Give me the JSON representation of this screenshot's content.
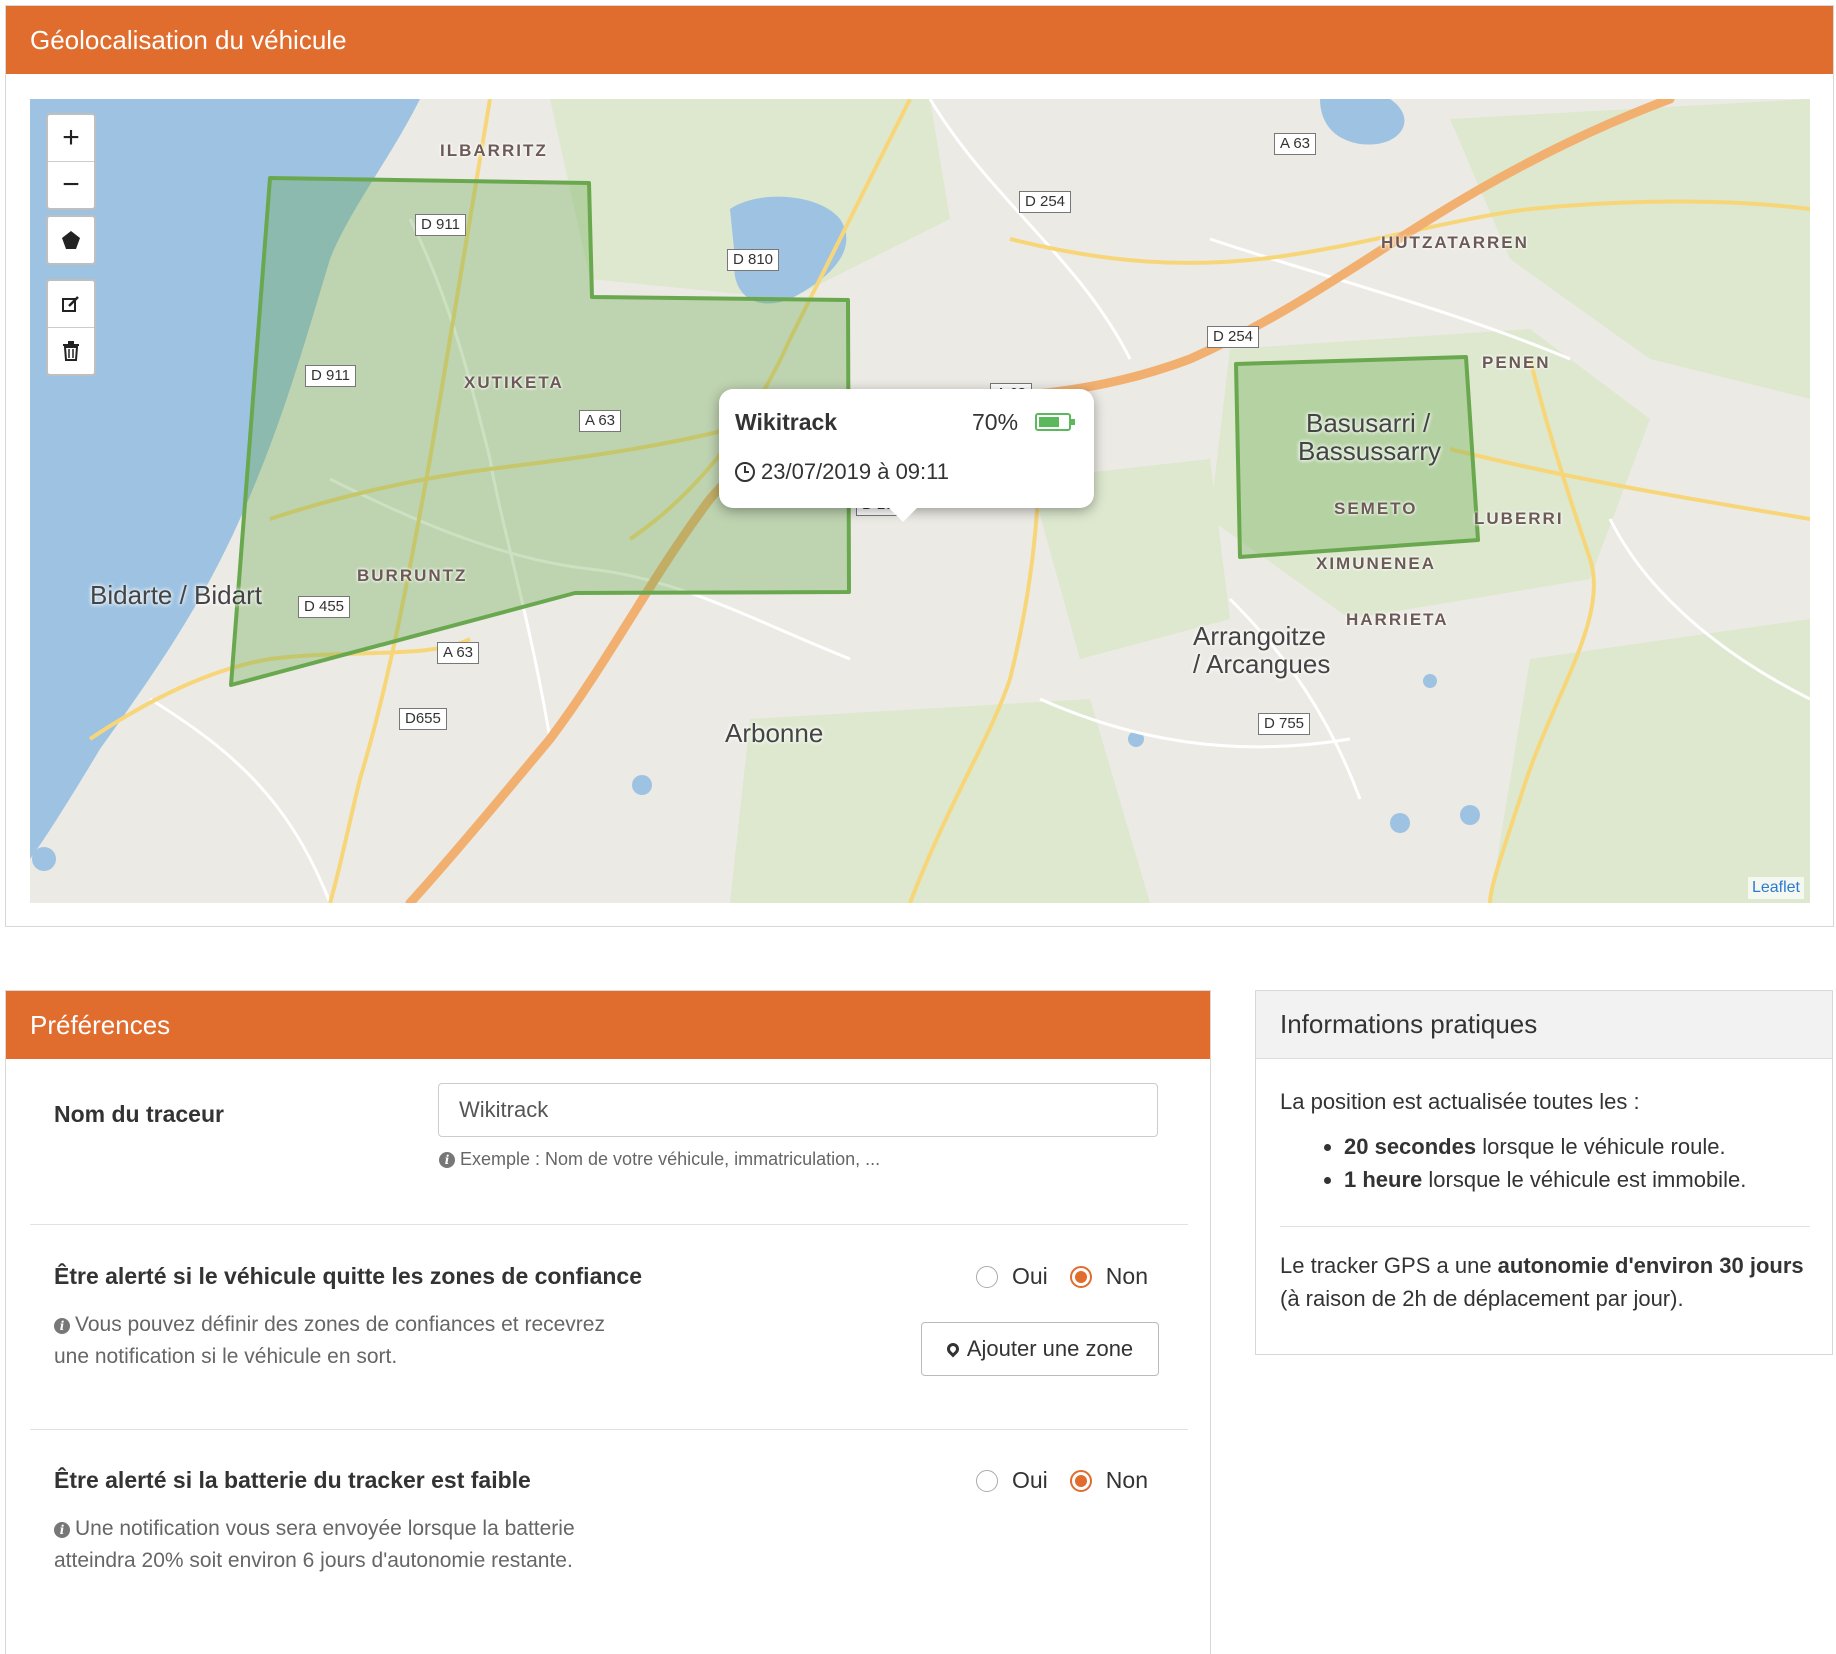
{
  "map_panel": {
    "title": "Géolocalisation du véhicule"
  },
  "map": {
    "controls": {
      "zoom_in": "+",
      "zoom_out": "−",
      "draw_polygon_icon": "polygon-icon",
      "edit_icon": "edit-icon",
      "delete_icon": "trash-icon"
    },
    "road_labels": [
      "D 911",
      "D 911",
      "D 810",
      "D 254",
      "A 63",
      "D 254",
      "A 63",
      "A 63",
      "D 255",
      "D 455",
      "A 63",
      "D655",
      "D 755"
    ],
    "place_labels": [
      "ILBARRITZ",
      "XUTIKETA",
      "BURRUNTZ",
      "HUTZATARREN",
      "PENEN",
      "SEMETO",
      "LUBERRI",
      "XIMUNENEA",
      "HARRIETA"
    ],
    "town_labels": [
      "Bidarte / Bidart",
      "Basusarri /",
      "Bassussarry",
      "Arrangoitze",
      "/ Arcangues",
      "Arbonne"
    ],
    "attribution": "Leaflet",
    "zone_color": "#6aa84f",
    "vehicle_icon": "truck-icon",
    "popup": {
      "tracker_name": "Wikitrack",
      "battery_percent": "70%",
      "battery_level": 0.7,
      "datetime": "23/07/2019 à 09:11"
    }
  },
  "preferences": {
    "title": "Préférences",
    "tracker_name_label": "Nom du traceur",
    "tracker_name_value": "Wikitrack",
    "tracker_name_hint": "Exemple : Nom de votre véhicule, immatriculation, ...",
    "zone_alert": {
      "label": "Être alerté si le véhicule quitte les zones de confiance",
      "hint_line1": "Vous pouvez définir des zones de confiances et recevrez",
      "hint_line2": "une notification si le véhicule en sort.",
      "yes": "Oui",
      "no": "Non",
      "selected": "Non",
      "add_zone_button": "Ajouter une zone"
    },
    "battery_alert": {
      "label": "Être alerté si la batterie du tracker est faible",
      "hint_line1": "Une notification vous sera envoyée lorsque la batterie",
      "hint_line2": "atteindra 20% soit environ 6 jours d'autonomie restante.",
      "yes": "Oui",
      "no": "Non",
      "selected": "Non"
    }
  },
  "info": {
    "title": "Informations pratiques",
    "intro": "La position est actualisée toutes les :",
    "item1_bold": "20 secondes",
    "item1_rest": " lorsque le véhicule roule.",
    "item2_bold": "1 heure",
    "item2_rest": " lorsque le véhicule est immobile.",
    "autonomy_pre": "Le tracker GPS a une ",
    "autonomy_bold1": "autonomie d'environ 30",
    "autonomy_bold2": "jours",
    "autonomy_rest": " (à raison de 2h de déplacement par jour)."
  },
  "colors": {
    "accent": "#e06c2e",
    "battery": "#5cb85c"
  }
}
